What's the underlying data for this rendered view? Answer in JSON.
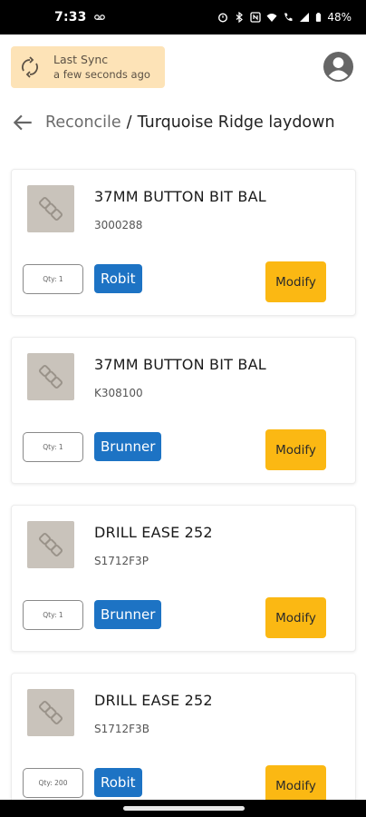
{
  "status_bar": {
    "time": "7:33",
    "battery": "48%",
    "icons": [
      "voicemail-icon",
      "alarm-icon",
      "bluetooth-icon",
      "nfc-icon",
      "wifi-icon",
      "call-icon",
      "signal-icon",
      "battery-icon"
    ]
  },
  "header": {
    "sync_title": "Last Sync",
    "sync_subtitle": "a few seconds ago",
    "sync_bg": "#fde3b7",
    "avatar_icon": "account-circle-icon"
  },
  "breadcrumb": {
    "parent": "Reconcile",
    "separator": "/",
    "current": "Turquoise Ridge laydown"
  },
  "colors": {
    "brand_button": "#1d73c4",
    "modify_button": "#fbb813",
    "thumbnail_bg": "#c9c3bb"
  },
  "items": [
    {
      "name": "37MM BUTTON BIT BAL",
      "code": "3000288",
      "qty": "Qty: 1",
      "brand": "Robit",
      "action": "Modify"
    },
    {
      "name": "37MM BUTTON BIT BAL",
      "code": "K308100",
      "qty": "Qty: 1",
      "brand": "Brunner",
      "action": "Modify"
    },
    {
      "name": "DRILL EASE 252",
      "code": "S1712F3P",
      "qty": "Qty: 1",
      "brand": "Brunner",
      "action": "Modify"
    },
    {
      "name": "DRILL EASE 252",
      "code": "S1712F3B",
      "qty": "Qty: 200",
      "brand": "Robit",
      "action": "Modify"
    }
  ]
}
